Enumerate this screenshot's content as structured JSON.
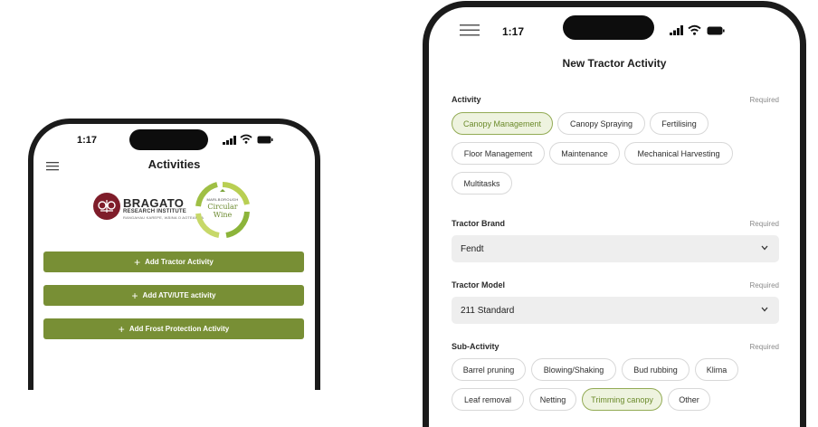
{
  "left_phone": {
    "time": "1:17",
    "title": "Activities",
    "logos": {
      "bragato": {
        "name": "BRAGATO",
        "subtitle": "RESEARCH INSTITUTE",
        "tagline": "RANGAHAU KAREPE, WĀINA O AOTEAROA"
      },
      "circular": {
        "region": "MARLBOROUGH",
        "name_line1": "Circular",
        "name_line2": "Wine"
      }
    },
    "buttons": [
      {
        "label": "Add Tractor Activity"
      },
      {
        "label": "Add ATV/UTE activity"
      },
      {
        "label": "Add Frost Protection Activity"
      }
    ],
    "colors": {
      "button": "#788f35",
      "frame": "#1b1b1b",
      "bragato": "#7f1d2a"
    }
  },
  "right_phone": {
    "time": "1:17",
    "title": "New Tractor Activity",
    "required_label": "Required",
    "activity": {
      "label": "Activity",
      "options": [
        {
          "label": "Canopy Management",
          "selected": true
        },
        {
          "label": "Canopy Spraying",
          "selected": false
        },
        {
          "label": "Fertilising",
          "selected": false
        },
        {
          "label": "Floor Management",
          "selected": false
        },
        {
          "label": "Maintenance",
          "selected": false
        },
        {
          "label": "Mechanical Harvesting",
          "selected": false
        },
        {
          "label": "Multitasks",
          "selected": false
        }
      ]
    },
    "tractor_brand": {
      "label": "Tractor Brand",
      "value": "Fendt"
    },
    "tractor_model": {
      "label": "Tractor Model",
      "value": "211 Standard"
    },
    "sub_activity": {
      "label": "Sub-Activity",
      "options": [
        {
          "label": "Barrel pruning",
          "selected": false
        },
        {
          "label": "Blowing/Shaking",
          "selected": false
        },
        {
          "label": "Bud rubbing",
          "selected": false
        },
        {
          "label": "Klima",
          "selected": false
        },
        {
          "label": "Leaf removal",
          "selected": false
        },
        {
          "label": "Netting",
          "selected": false
        },
        {
          "label": "Trimming canopy",
          "selected": true
        },
        {
          "label": "Other",
          "selected": false
        }
      ]
    },
    "colors": {
      "chip_selected_bg": "#eef3df",
      "chip_selected_border": "#93ab55",
      "chip_selected_text": "#6b8a2a",
      "select_bg": "#eeeeee"
    }
  }
}
